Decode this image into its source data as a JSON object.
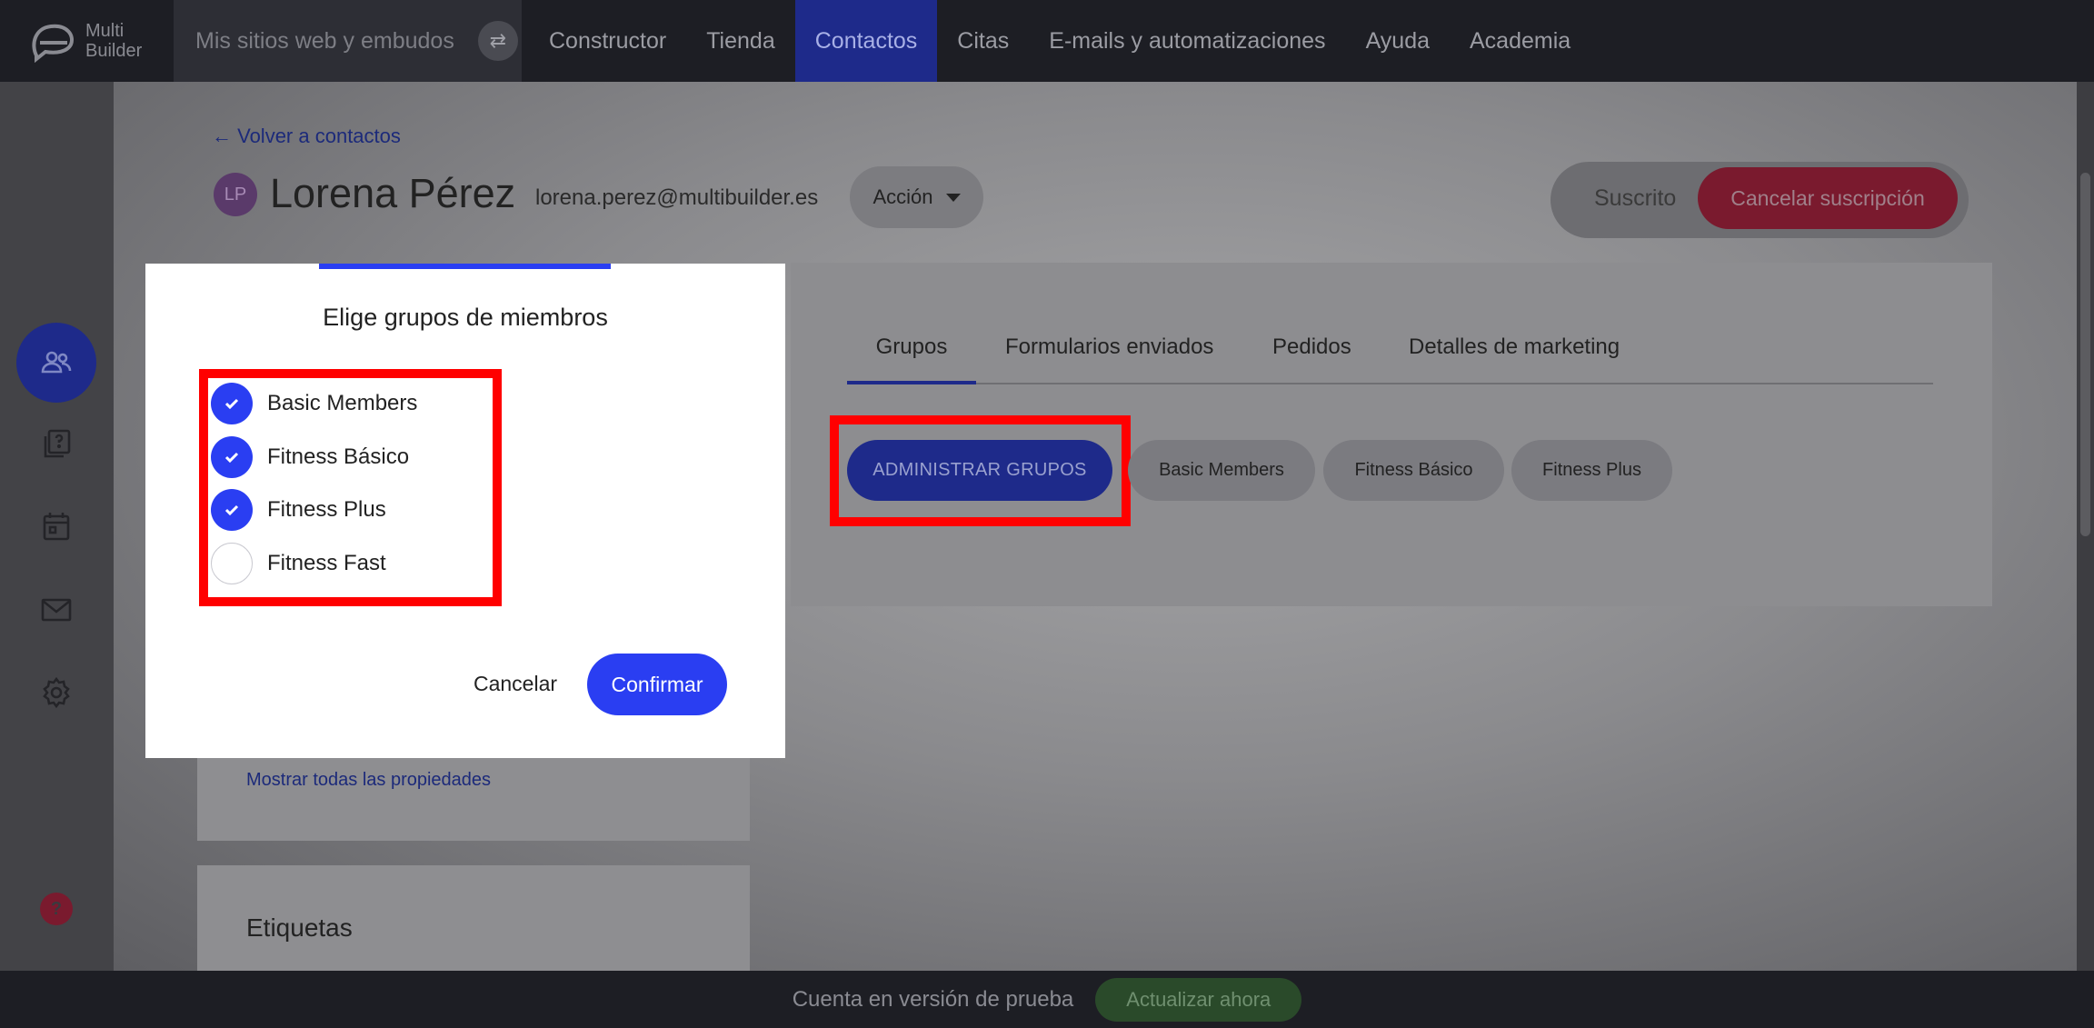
{
  "topbar": {
    "logo_line1": "Multi",
    "logo_line2": "Builder",
    "sites_label": "Mis sitios web y embudos",
    "nav": [
      {
        "label": "Constructor",
        "active": false
      },
      {
        "label": "Tienda",
        "active": false
      },
      {
        "label": "Contactos",
        "active": true
      },
      {
        "label": "Citas",
        "active": false
      },
      {
        "label": "E-mails y automatizaciones",
        "active": false
      },
      {
        "label": "Ayuda",
        "active": false
      },
      {
        "label": "Academia",
        "active": false
      }
    ]
  },
  "sidebar": {
    "icons": [
      "contacts-icon",
      "pages-icon",
      "calendar-icon",
      "mail-icon",
      "settings-icon"
    ],
    "help": "?"
  },
  "contact": {
    "back_link": "← Volver a contactos",
    "initials": "LP",
    "name": "Lorena Pérez",
    "email": "lorena.perez@multibuilder.es",
    "action_label": "Acción",
    "status_label": "Suscrito",
    "cancel_subscription_label": "Cancelar suscripción"
  },
  "tabs": [
    {
      "label": "Grupos",
      "active": true
    },
    {
      "label": "Formularios enviados",
      "active": false
    },
    {
      "label": "Pedidos",
      "active": false
    },
    {
      "label": "Detalles de marketing",
      "active": false
    }
  ],
  "groups": {
    "manage_label": "ADMINISTRAR GRUPOS",
    "chips": [
      "Basic Members",
      "Fitness Básico",
      "Fitness Plus"
    ]
  },
  "left_panel": {
    "show_all_label": "Mostrar todas las propiedades",
    "tags_title": "Etiquetas"
  },
  "modal": {
    "title": "Elige grupos de miembros",
    "options": [
      {
        "label": "Basic Members",
        "checked": true
      },
      {
        "label": "Fitness Básico",
        "checked": true
      },
      {
        "label": "Fitness Plus",
        "checked": true
      },
      {
        "label": "Fitness Fast",
        "checked": false
      }
    ],
    "cancel_label": "Cancelar",
    "confirm_label": "Confirmar"
  },
  "bottombar": {
    "trial_text": "Cuenta en versión de prueba",
    "upgrade_label": "Actualizar ahora"
  },
  "colors": {
    "accent": "#2a3ef2",
    "highlight": "#ff0000",
    "danger": "#c0143c",
    "success": "#3f8f3f"
  }
}
